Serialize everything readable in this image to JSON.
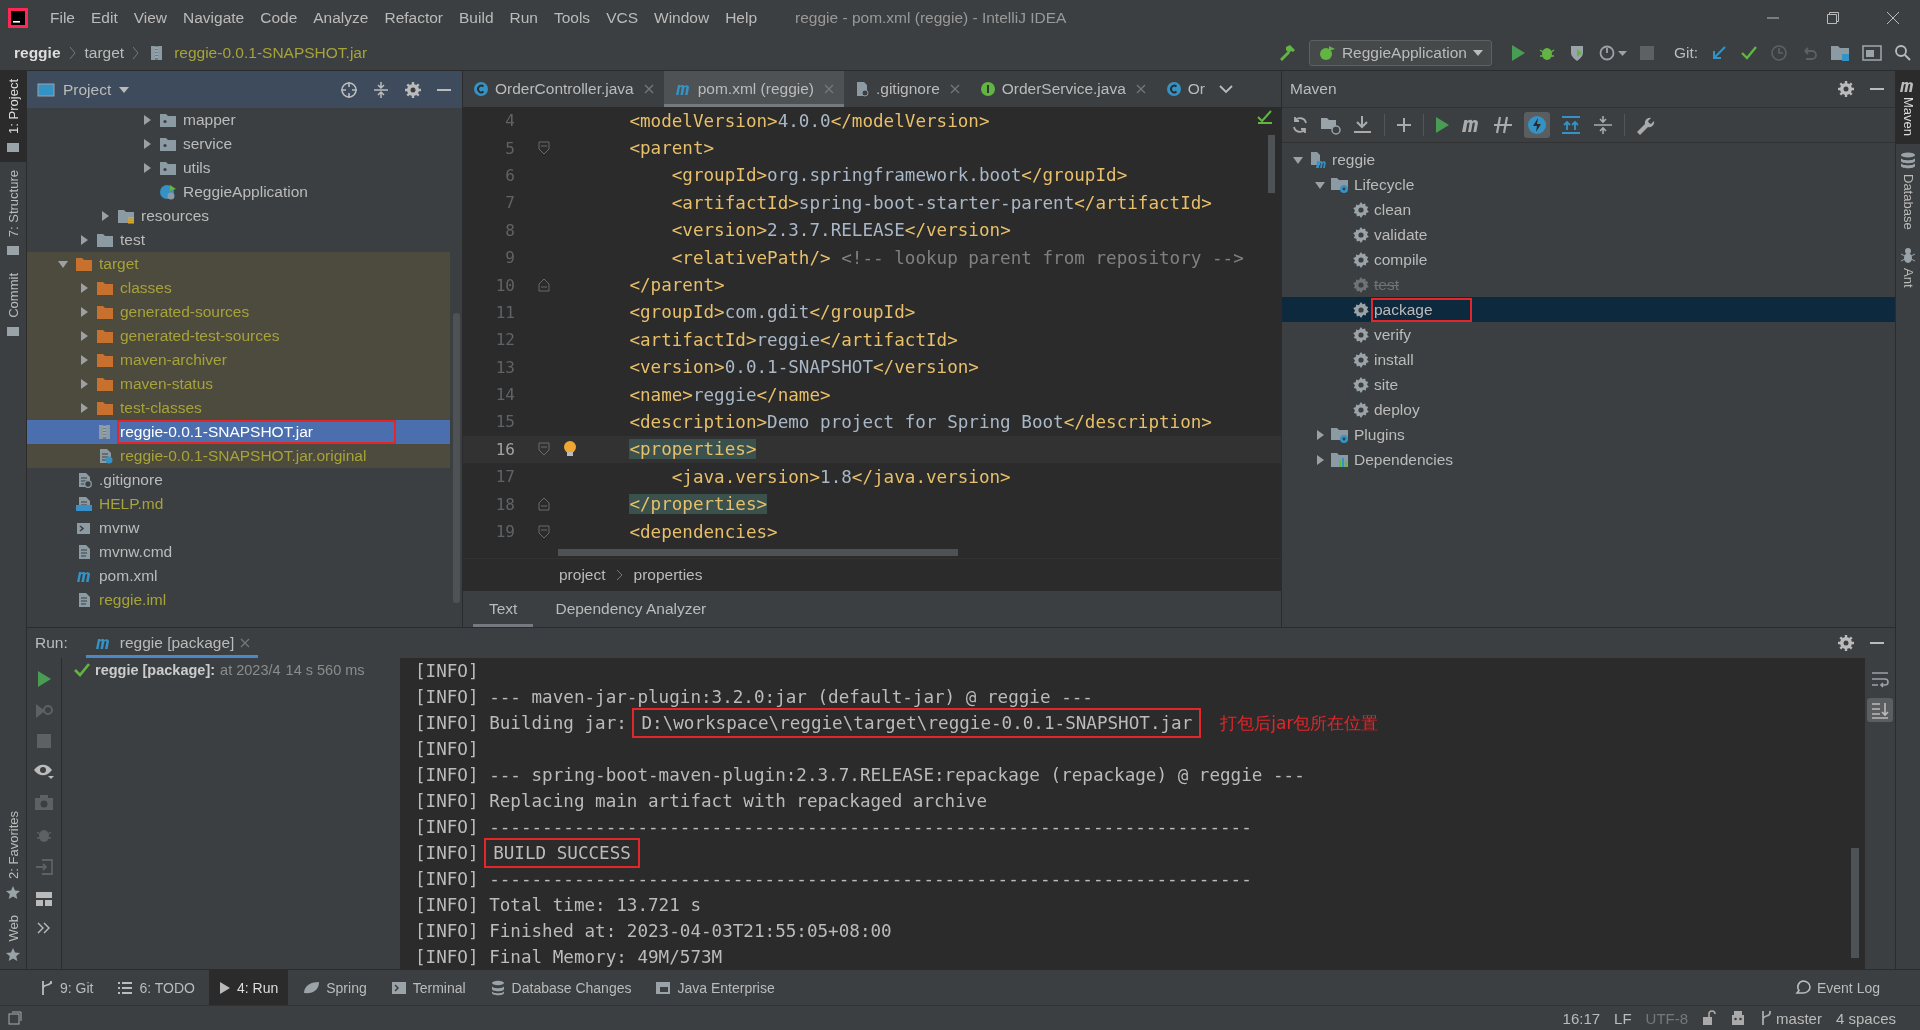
{
  "window": {
    "title": "reggie - pom.xml (reggie) - IntelliJ IDEA"
  },
  "menu": [
    "File",
    "Edit",
    "View",
    "Navigate",
    "Code",
    "Analyze",
    "Refactor",
    "Build",
    "Run",
    "Tools",
    "VCS",
    "Window",
    "Help"
  ],
  "breadcrumb": [
    {
      "label": "reggie",
      "kind": "project"
    },
    {
      "label": "target",
      "kind": "folder"
    },
    {
      "label": "reggie-0.0.1-SNAPSHOT.jar",
      "kind": "jar"
    }
  ],
  "toolbar": {
    "run_configuration": "ReggieApplication",
    "git_label": "Git:"
  },
  "left_tool_strip": {
    "top": [
      {
        "label": "1: Project",
        "selected": true
      },
      {
        "label": "7: Structure",
        "selected": false
      },
      {
        "label": "Commit",
        "selected": false
      }
    ],
    "bottom": [
      {
        "label": "2: Favorites",
        "selected": false
      },
      {
        "label": "Web",
        "selected": false
      }
    ]
  },
  "project_panel": {
    "title": "Project",
    "tree": [
      {
        "children": [
          {
            "children": [
              {
                "children": [
                  {
                    "children": [
                      {
                        "label": "mapper",
                        "kind": "package",
                        "expanded": false,
                        "selected": false,
                        "excluded": false,
                        "ignored": false,
                        "highlighted": false
                      },
                      {
                        "label": "service",
                        "kind": "package",
                        "expanded": false,
                        "selected": false,
                        "excluded": false,
                        "ignored": false,
                        "highlighted": false
                      },
                      {
                        "label": "utils",
                        "kind": "package",
                        "expanded": false,
                        "selected": false,
                        "excluded": false,
                        "ignored": false,
                        "highlighted": false
                      },
                      {
                        "label": "ReggieApplication",
                        "kind": "spring-class",
                        "selected": false,
                        "excluded": false,
                        "ignored": false,
                        "highlighted": false
                      }
                    ]
                  }
                ]
              },
              {
                "label": "resources",
                "kind": "resources",
                "expanded": false,
                "selected": false,
                "excluded": false,
                "ignored": false,
                "highlighted": false
              }
            ]
          },
          {
            "label": "test",
            "kind": "folder",
            "expanded": false,
            "selected": false,
            "excluded": false,
            "ignored": false,
            "highlighted": false
          }
        ]
      },
      {
        "label": "target",
        "kind": "folder",
        "expanded": true,
        "selected": false,
        "excluded": true,
        "ignored": true,
        "highlighted": false,
        "children": [
          {
            "label": "classes",
            "kind": "folder",
            "expanded": false,
            "selected": false,
            "excluded": true,
            "ignored": true,
            "highlighted": false
          },
          {
            "label": "generated-sources",
            "kind": "folder",
            "expanded": false,
            "selected": false,
            "excluded": true,
            "ignored": true,
            "highlighted": false
          },
          {
            "label": "generated-test-sources",
            "kind": "folder",
            "expanded": false,
            "selected": false,
            "excluded": true,
            "ignored": true,
            "highlighted": false
          },
          {
            "label": "maven-archiver",
            "kind": "folder",
            "expanded": false,
            "selected": false,
            "excluded": true,
            "ignored": true,
            "highlighted": false
          },
          {
            "label": "maven-status",
            "kind": "folder",
            "expanded": false,
            "selected": false,
            "excluded": true,
            "ignored": true,
            "highlighted": false
          },
          {
            "label": "test-classes",
            "kind": "folder",
            "expanded": false,
            "selected": false,
            "excluded": true,
            "ignored": true,
            "highlighted": false
          },
          {
            "label": "reggie-0.0.1-SNAPSHOT.jar",
            "kind": "jar",
            "selected": true,
            "excluded": true,
            "ignored": true,
            "highlighted": true
          },
          {
            "label": "reggie-0.0.1-SNAPSHOT.jar.original",
            "kind": "unknown-file",
            "selected": false,
            "excluded": true,
            "ignored": true,
            "highlighted": false
          }
        ]
      },
      {
        "label": ".gitignore",
        "kind": "ignore-file",
        "selected": false,
        "excluded": false,
        "ignored": false,
        "highlighted": false
      },
      {
        "label": "HELP.md",
        "kind": "markdown",
        "selected": false,
        "excluded": false,
        "ignored": true,
        "highlighted": false
      },
      {
        "label": "mvnw",
        "kind": "script",
        "selected": false,
        "excluded": false,
        "ignored": false,
        "highlighted": false
      },
      {
        "label": "mvnw.cmd",
        "kind": "text-file",
        "selected": false,
        "excluded": false,
        "ignored": false,
        "highlighted": false
      },
      {
        "label": "pom.xml",
        "kind": "maven",
        "selected": false,
        "excluded": false,
        "ignored": false,
        "highlighted": false
      },
      {
        "label": "reggie.iml",
        "kind": "text-file",
        "selected": false,
        "excluded": false,
        "ignored": true,
        "highlighted": false
      }
    ]
  },
  "editor": {
    "tabs": [
      {
        "label": "OrderController.java",
        "kind": "class",
        "selected": false
      },
      {
        "label": "pom.xml (reggie)",
        "kind": "maven",
        "selected": true
      },
      {
        "label": ".gitignore",
        "kind": "ignore-file",
        "selected": false
      },
      {
        "label": "OrderService.java",
        "kind": "interface",
        "selected": false
      },
      {
        "label": "Or",
        "kind": "class",
        "selected": false
      }
    ],
    "lines": [
      {
        "number": "4",
        "text": "    <modelVersion>4.0.0</modelVersion>",
        "fold_start": false,
        "fold_end": false,
        "current": false,
        "matched": false,
        "intention": false
      },
      {
        "number": "5",
        "text": "    <parent>",
        "fold_start": true,
        "fold_end": false,
        "current": false,
        "matched": false,
        "intention": false
      },
      {
        "number": "6",
        "text": "        <groupId>org.springframework.boot</groupId>",
        "fold_start": false,
        "fold_end": false,
        "current": false,
        "matched": false,
        "intention": false
      },
      {
        "number": "7",
        "text": "        <artifactId>spring-boot-starter-parent</artifactId>",
        "fold_start": false,
        "fold_end": false,
        "current": false,
        "matched": false,
        "intention": false
      },
      {
        "number": "8",
        "text": "        <version>2.3.7.RELEASE</version>",
        "fold_start": false,
        "fold_end": false,
        "current": false,
        "matched": false,
        "intention": false
      },
      {
        "number": "9",
        "text": "        <relativePath/> <!-- lookup parent from repository -->",
        "fold_start": false,
        "fold_end": false,
        "current": false,
        "matched": false,
        "intention": false
      },
      {
        "number": "10",
        "text": "    </parent>",
        "fold_start": false,
        "fold_end": true,
        "current": false,
        "matched": false,
        "intention": false
      },
      {
        "number": "11",
        "text": "    <groupId>com.gdit</groupId>",
        "fold_start": false,
        "fold_end": false,
        "current": false,
        "matched": false,
        "intention": false
      },
      {
        "number": "12",
        "text": "    <artifactId>reggie</artifactId>",
        "fold_start": false,
        "fold_end": false,
        "current": false,
        "matched": false,
        "intention": false
      },
      {
        "number": "13",
        "text": "    <version>0.0.1-SNAPSHOT</version>",
        "fold_start": false,
        "fold_end": false,
        "current": false,
        "matched": false,
        "intention": false
      },
      {
        "number": "14",
        "text": "    <name>reggie</name>",
        "fold_start": false,
        "fold_end": false,
        "current": false,
        "matched": false,
        "intention": false
      },
      {
        "number": "15",
        "text": "    <description>Demo project for Spring Boot</description>",
        "fold_start": false,
        "fold_end": false,
        "current": false,
        "matched": false,
        "intention": false
      },
      {
        "number": "16",
        "text": "    <properties>",
        "fold_start": true,
        "fold_end": false,
        "current": true,
        "matched": true,
        "intention": true
      },
      {
        "number": "17",
        "text": "        <java.version>1.8</java.version>",
        "fold_start": false,
        "fold_end": false,
        "current": false,
        "matched": false,
        "intention": false
      },
      {
        "number": "18",
        "text": "    </properties>",
        "fold_start": false,
        "fold_end": true,
        "current": false,
        "matched": true,
        "intention": false
      },
      {
        "number": "19",
        "text": "    <dependencies>",
        "fold_start": true,
        "fold_end": false,
        "current": false,
        "matched": false,
        "intention": false
      }
    ],
    "breadcrumb": [
      "project",
      "properties"
    ],
    "bottom_tabs": [
      {
        "label": "Text",
        "selected": true
      },
      {
        "label": "Dependency Analyzer",
        "selected": false
      }
    ]
  },
  "maven_panel": {
    "title": "Maven",
    "skip_tests_on": true,
    "tree": [
      {
        "label": "reggie",
        "kind": "project",
        "expanded": true,
        "selected": false,
        "disabled": false,
        "highlighted": false,
        "children": [
          {
            "label": "Lifecycle",
            "kind": "lifecycle",
            "expanded": true,
            "selected": false,
            "disabled": false,
            "highlighted": false,
            "children": [
              {
                "label": "clean",
                "kind": "goal",
                "selected": false,
                "disabled": false,
                "highlighted": false
              },
              {
                "label": "validate",
                "kind": "goal",
                "selected": false,
                "disabled": false,
                "highlighted": false
              },
              {
                "label": "compile",
                "kind": "goal",
                "selected": false,
                "disabled": false,
                "highlighted": false
              },
              {
                "label": "test",
                "kind": "goal",
                "selected": false,
                "disabled": true,
                "highlighted": false
              },
              {
                "label": "package",
                "kind": "goal",
                "selected": true,
                "disabled": false,
                "highlighted": true
              },
              {
                "label": "verify",
                "kind": "goal",
                "selected": false,
                "disabled": false,
                "highlighted": false
              },
              {
                "label": "install",
                "kind": "goal",
                "selected": false,
                "disabled": false,
                "highlighted": false
              },
              {
                "label": "site",
                "kind": "goal",
                "selected": false,
                "disabled": false,
                "highlighted": false
              },
              {
                "label": "deploy",
                "kind": "goal",
                "selected": false,
                "disabled": false,
                "highlighted": false
              }
            ]
          },
          {
            "label": "Plugins",
            "kind": "lifecycle",
            "expanded": false,
            "selected": false,
            "disabled": false,
            "highlighted": false
          },
          {
            "label": "Dependencies",
            "kind": "dependencies",
            "expanded": false,
            "selected": false,
            "disabled": false,
            "highlighted": false
          }
        ]
      }
    ]
  },
  "right_tool_strip": [
    {
      "label": "Maven",
      "kind": "maven",
      "selected": true
    },
    {
      "label": "Database",
      "kind": "database",
      "selected": false
    },
    {
      "label": "Ant",
      "kind": "ant",
      "selected": false
    }
  ],
  "run_panel": {
    "label": "Run:",
    "tab": "reggie [package]",
    "result": {
      "name": "reggie [package]:",
      "time": "at 2023/4",
      "duration": "14 s 560 ms",
      "success": true
    },
    "console": [
      {
        "text": "[INFO]"
      },
      {
        "text": "[INFO] --- maven-jar-plugin:3.2.0:jar (default-jar) @ reggie ---"
      },
      {
        "text": "[INFO] Building jar: ",
        "boxed": "D:\\workspace\\reggie\\target\\reggie-0.0.1-SNAPSHOT.jar",
        "note": "打包后jar包所在位置"
      },
      {
        "text": "[INFO]"
      },
      {
        "text": "[INFO] --- spring-boot-maven-plugin:2.3.7.RELEASE:repackage (repackage) @ reggie ---"
      },
      {
        "text": "[INFO] Replacing main artifact with repackaged archive"
      },
      {
        "text": "[INFO] ------------------------------------------------------------------------"
      },
      {
        "text": "[INFO] ",
        "boxed": "BUILD SUCCESS"
      },
      {
        "text": "[INFO] ------------------------------------------------------------------------"
      },
      {
        "text": "[INFO] Total time: 13.721 s"
      },
      {
        "text": "[INFO] Finished at: 2023-04-03T21:55:05+08:00"
      },
      {
        "text": "[INFO] Final Memory: 49M/573M"
      }
    ]
  },
  "tool_windows": [
    {
      "label": "9: Git",
      "kind": "git",
      "selected": false
    },
    {
      "label": "6: TODO",
      "kind": "todo",
      "selected": false
    },
    {
      "label": "4: Run",
      "kind": "run",
      "selected": true
    },
    {
      "label": "Spring",
      "kind": "spring",
      "selected": false
    },
    {
      "label": "Terminal",
      "kind": "terminal",
      "selected": false
    },
    {
      "label": "Database Changes",
      "kind": "database",
      "selected": false
    },
    {
      "label": "Java Enterprise",
      "kind": "enterprise",
      "selected": false
    }
  ],
  "event_log": "Event Log",
  "status_bar": {
    "position": "16:17",
    "line_separator": "LF",
    "encoding": "UTF-8",
    "branch": "master",
    "indent": "4 spaces"
  }
}
